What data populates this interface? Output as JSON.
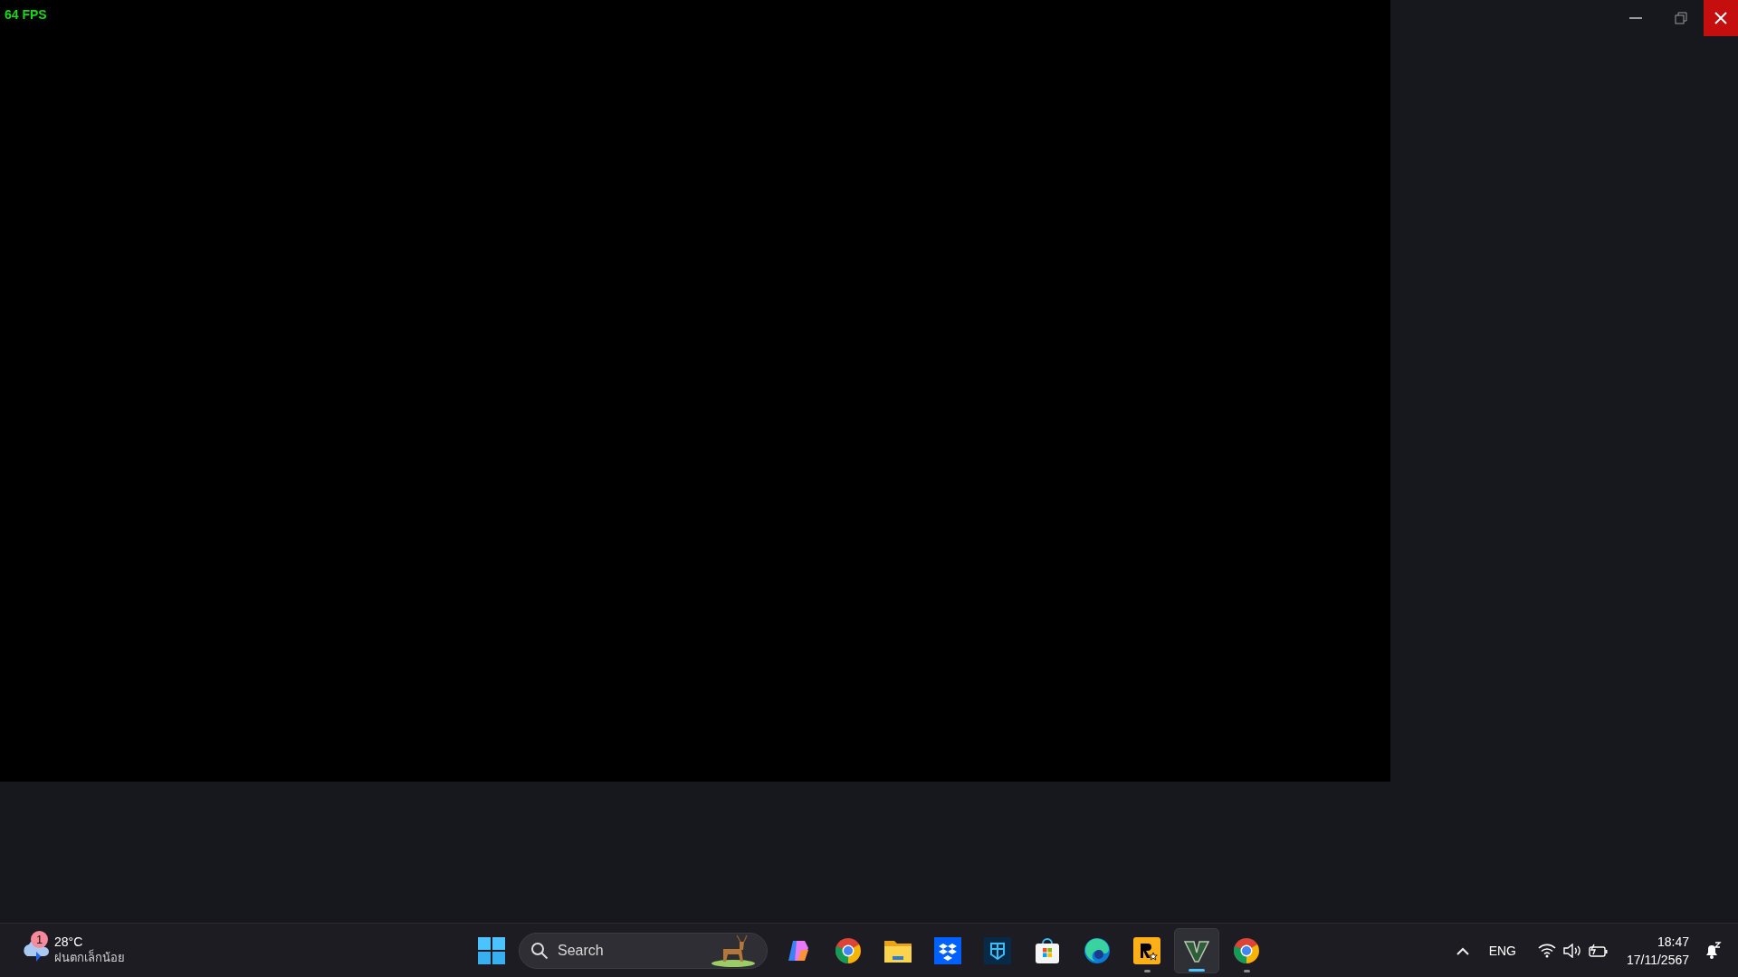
{
  "game": {
    "fps": "64 FPS"
  },
  "window_controls": [
    {
      "kind": "minimize"
    },
    {
      "kind": "restore"
    },
    {
      "kind": "close"
    }
  ],
  "taskbar": {
    "weather": {
      "badge": "1",
      "temperature": "28°C",
      "condition": "ฝนตกเล็กน้อย"
    },
    "search": {
      "placeholder": "Search"
    },
    "apps": [
      {
        "kind": "copilot",
        "running": false,
        "selected": false
      },
      {
        "kind": "chrome",
        "running": false,
        "selected": false
      },
      {
        "kind": "explorer",
        "running": false,
        "selected": false
      },
      {
        "kind": "dropbox",
        "running": false,
        "selected": false
      },
      {
        "kind": "shield",
        "running": false,
        "selected": false
      },
      {
        "kind": "store",
        "running": false,
        "selected": false
      },
      {
        "kind": "edge",
        "running": false,
        "selected": false
      },
      {
        "kind": "rockstar",
        "running": true,
        "selected": false
      },
      {
        "kind": "v",
        "running": true,
        "selected": true
      },
      {
        "kind": "chrome",
        "running": true,
        "selected": false
      }
    ],
    "tray": {
      "language": "ENG",
      "time": "18:47",
      "date": "17/11/2567"
    }
  }
}
